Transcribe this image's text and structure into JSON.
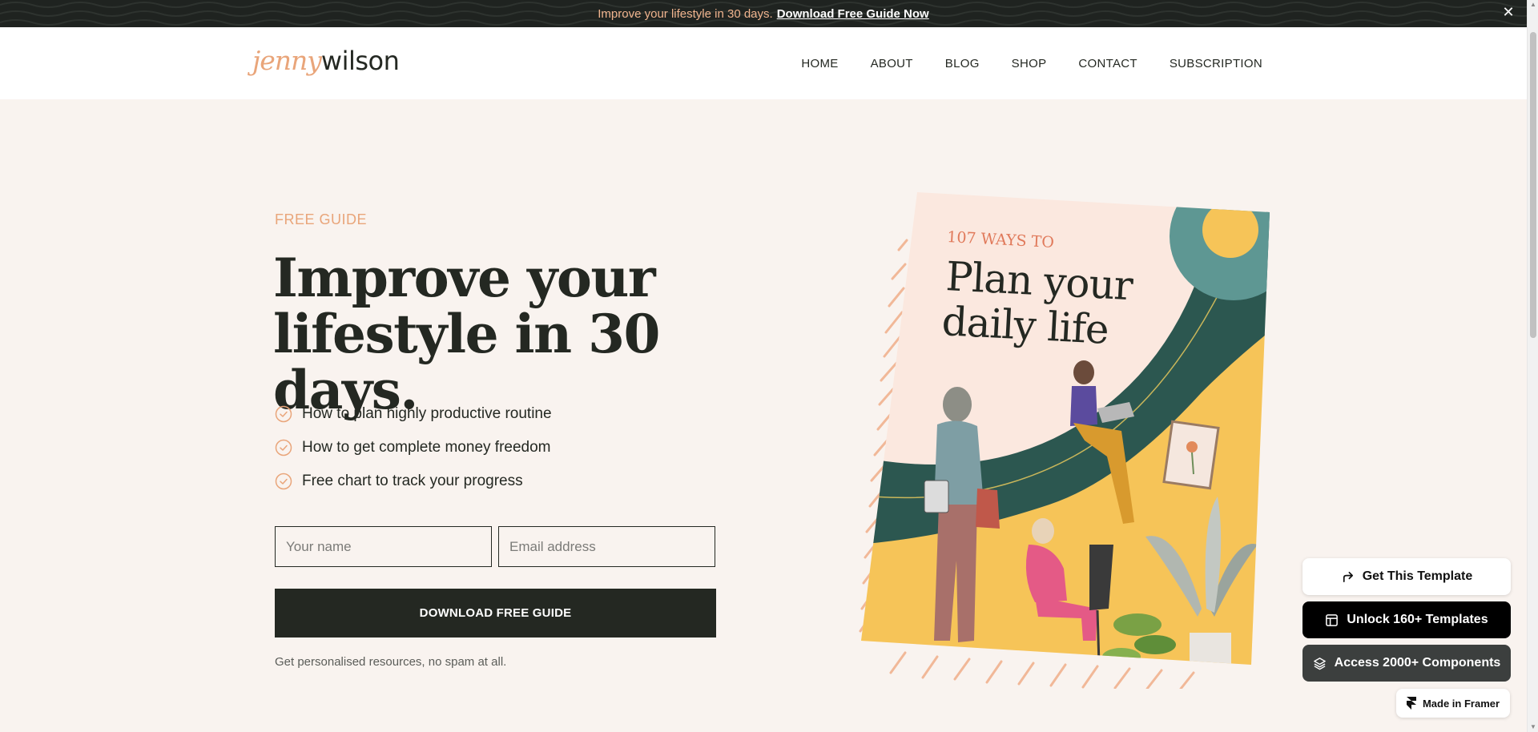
{
  "announcement": {
    "text": "Improve your lifestyle in 30 days.",
    "link": "Download Free Guide Now",
    "close_icon": "close-icon"
  },
  "header": {
    "logo_first": "jenny",
    "logo_second": "wilson",
    "nav": [
      "HOME",
      "ABOUT",
      "BLOG",
      "SHOP",
      "CONTACT",
      "SUBSCRIPTION"
    ]
  },
  "hero": {
    "eyebrow": "FREE GUIDE",
    "title_line1": "Improve your",
    "title_line2": "lifestyle in 30 days.",
    "bullets": [
      "How to plan highly productive routine",
      "How to get complete money freedom",
      "Free chart to track your progress"
    ],
    "bullet_icon": "check-circle-icon",
    "name_placeholder": "Your name",
    "email_placeholder": "Email address",
    "cta_label": "DOWNLOAD FREE GUIDE",
    "note": "Get personalised resources, no spam at all."
  },
  "book": {
    "kicker": "107 WAYS TO",
    "title_line1": "Plan your",
    "title_line2": "daily life"
  },
  "framer": {
    "get_template": "Get This Template",
    "unlock": "Unlock 160+ Templates",
    "access": "Access 2000+ Components",
    "made_in": "Made in Framer"
  },
  "colors": {
    "accent": "#e9a57a",
    "dark": "#242822",
    "background": "#f9f3ef",
    "book_teal": "#2c5750",
    "book_yellow": "#f6c458",
    "book_pink": "#fbe8df"
  }
}
